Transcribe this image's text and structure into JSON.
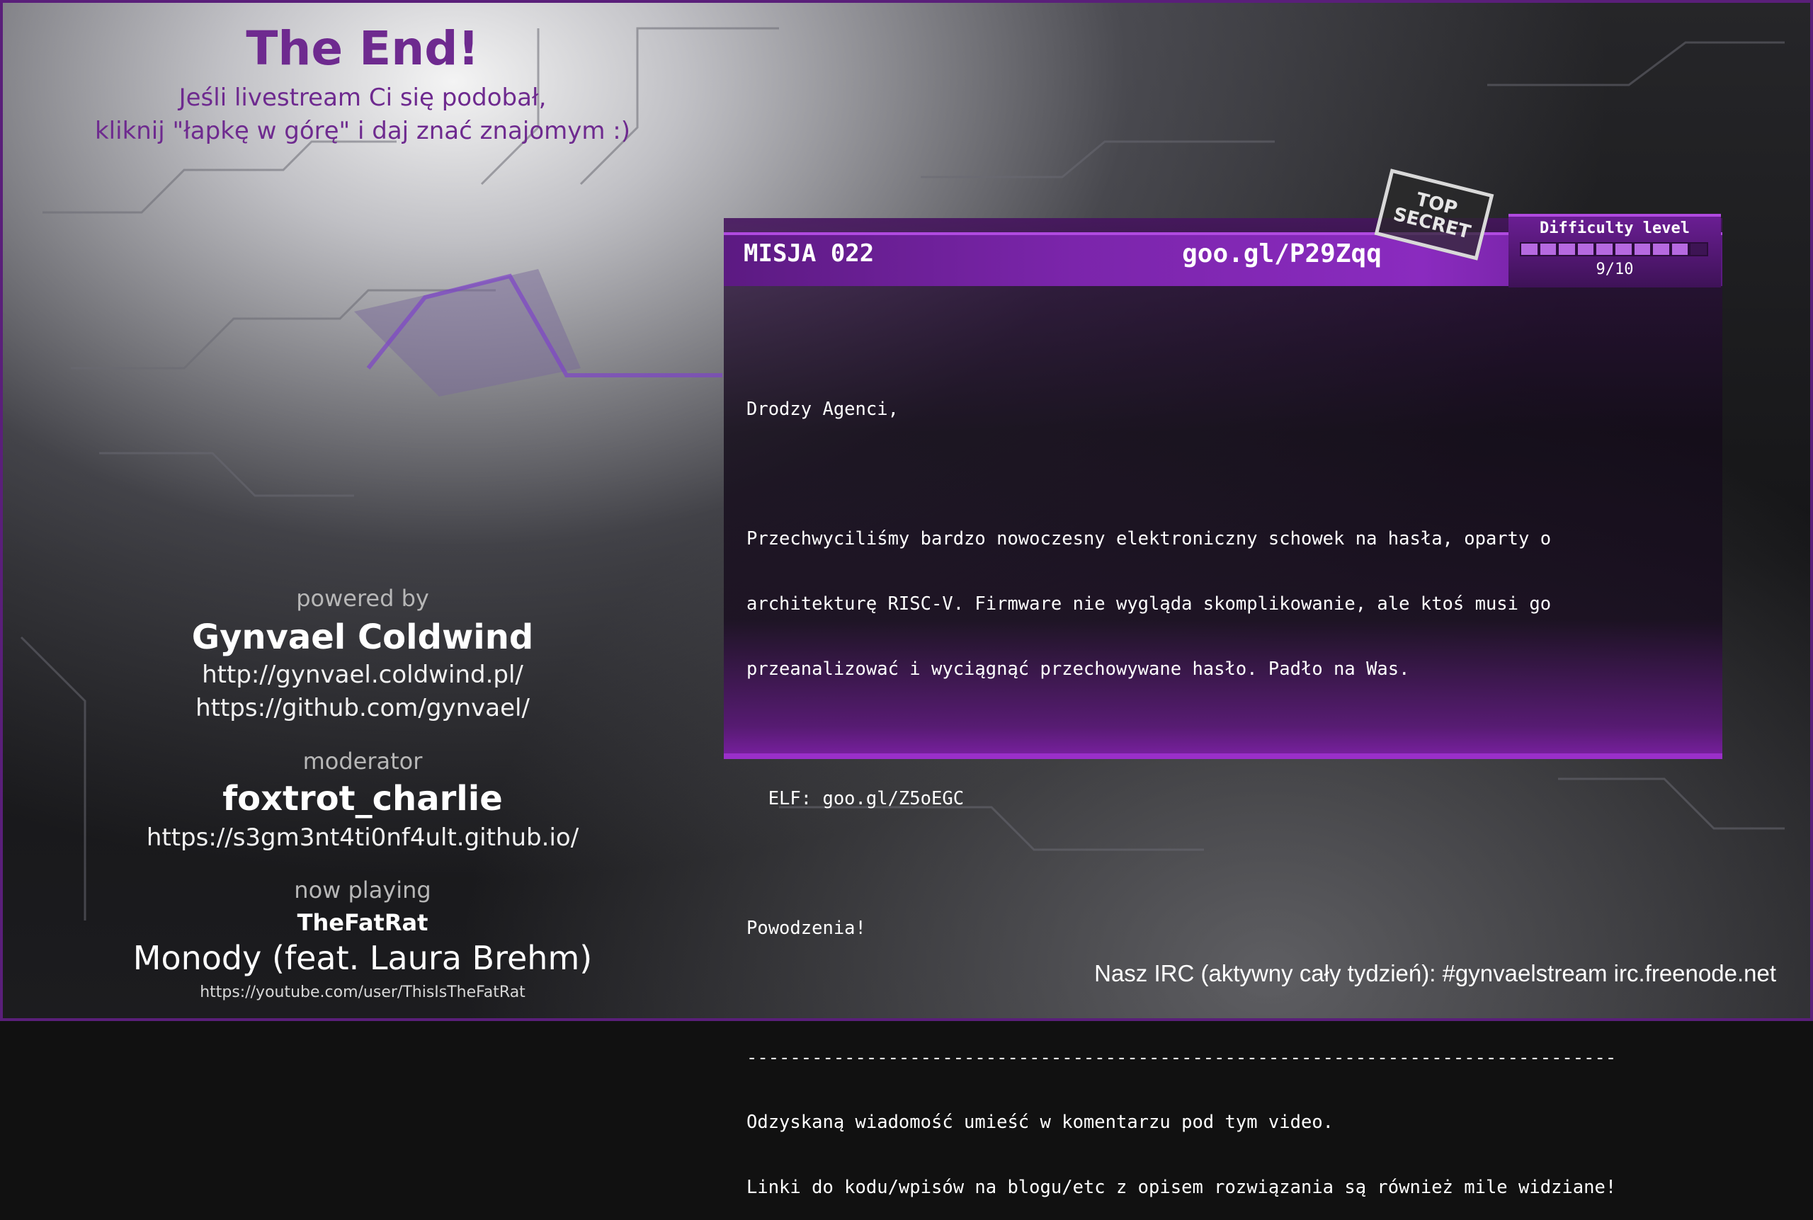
{
  "ending": {
    "title": "The End!",
    "line1": "Jeśli livestream Ci się podobał,",
    "line2": "kliknij \"łapkę w górę\" i daj znać znajomym :)"
  },
  "credits": {
    "powered_label": "powered by",
    "author": "Gynvael Coldwind",
    "author_site": "http://gynvael.coldwind.pl/",
    "author_github": "https://github.com/gynvael/",
    "moderator_label": "moderator",
    "moderator": "foxtrot_charlie",
    "moderator_site": "https://s3gm3nt4ti0nf4ult.github.io/"
  },
  "now_playing": {
    "label": "now playing",
    "artist": "TheFatRat",
    "track": "Monody (feat. Laura Brehm)",
    "url": "https://youtube.com/user/ThisIsTheFatRat"
  },
  "mission": {
    "id": "MISJA 022",
    "url": "goo.gl/P29Zqq",
    "stamp": "TOP SECRET",
    "difficulty_label": "Difficulty level",
    "difficulty_value": "9/10",
    "difficulty_fraction": 0.9,
    "greeting": "Drodzy Agenci,",
    "p1_l1": "Przechwyciliśmy bardzo nowoczesny elektroniczny schowek na hasła, oparty o",
    "p1_l2": "architekturę RISC-V. Firmware nie wygląda skomplikowanie, ale ktoś musi go",
    "p1_l3": "przeanalizować i wyciągnąć przechowywane hasło. Padło na Was.",
    "elf": "  ELF: goo.gl/Z5oEGC",
    "good_luck": "Powodzenia!",
    "divider": "--------------------------------------------------------------------------------",
    "footer1": "Odzyskaną wiadomość umieść w komentarzu pod tym video.",
    "footer2": "Linki do kodu/wpisów na blogu/etc z opisem rozwiązania są również mile widziane!"
  },
  "irc": "Nasz IRC (aktywny cały tydzień): #gynvaelstream irc.freenode.net",
  "colors": {
    "accent": "#7b25ab",
    "title": "#6e2a8f"
  }
}
